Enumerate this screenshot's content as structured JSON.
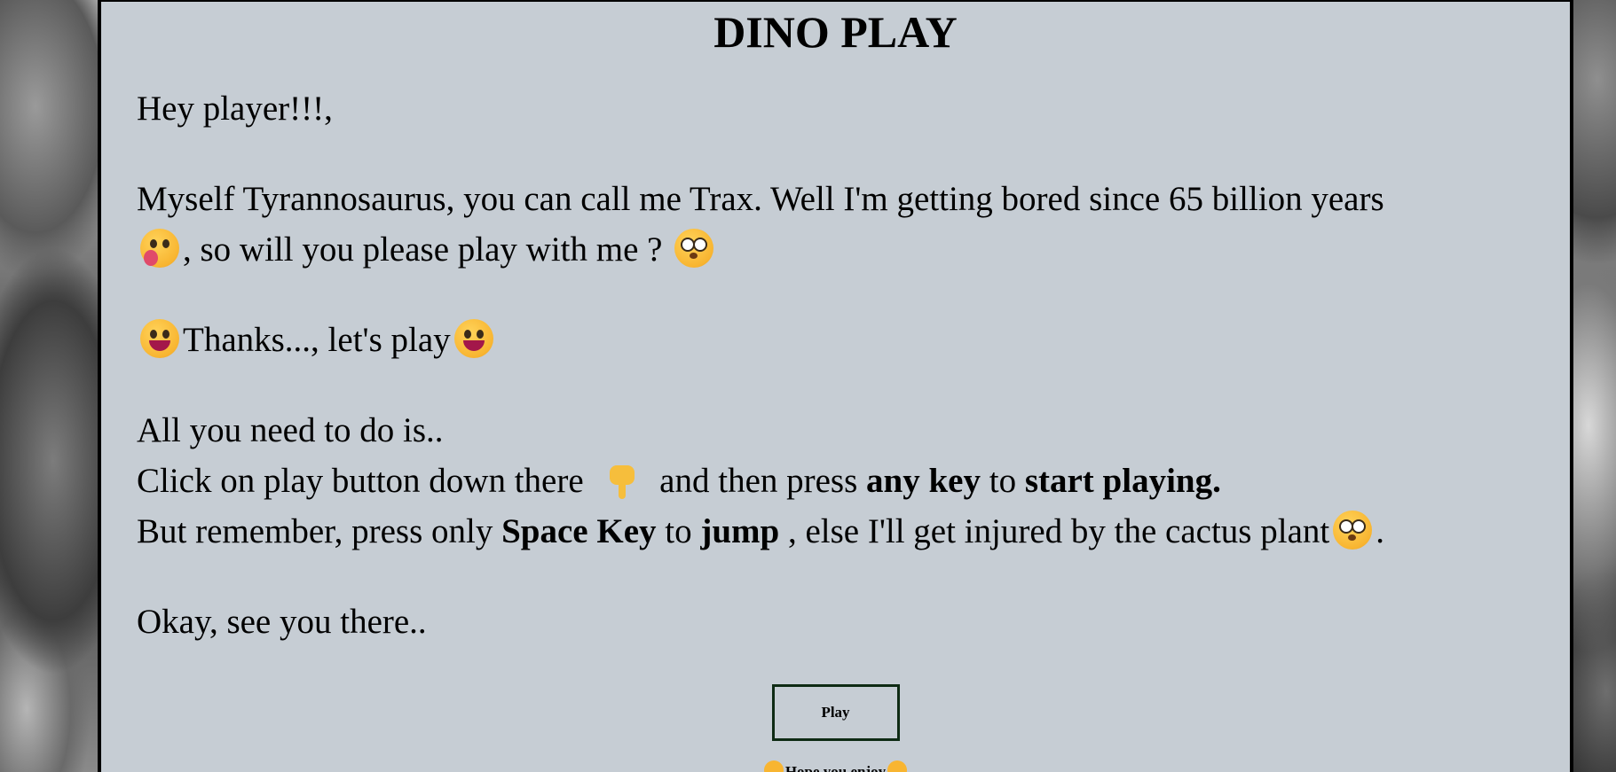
{
  "page": {
    "title": "DINO PLAY"
  },
  "intro": {
    "greeting": "Hey player!!!,",
    "line1_text": "Myself Tyrannosaurus, you can call me Trax. Well I'm getting bored since 65 billion years",
    "line2_text": ", so will you please play with me ?",
    "thanks_text": "Thanks..., let's play"
  },
  "instructions": {
    "lead": "All you need to do is..",
    "click_before": "Click on play button down there",
    "click_middle": "and then press",
    "any_key": "any key",
    "to_word": "to",
    "start_playing": "start playing.",
    "remember_before": "But remember, press only",
    "space_key": "Space Key",
    "to_word2": "to",
    "jump": "jump",
    "remember_after": ", else I'll get injured by the cactus plant",
    "period": "."
  },
  "outro": {
    "text": "Okay, see you there.."
  },
  "play_button": {
    "label": "Play"
  },
  "footer": {
    "note": "Hope you enjoy"
  },
  "icons": {
    "yawn": "yawning-face-icon",
    "flushed": "flushed-face-icon",
    "grin": "grinning-face-icon",
    "point_down": "backhand-index-pointing-down-icon",
    "pleading": "pleading-face-icon"
  }
}
